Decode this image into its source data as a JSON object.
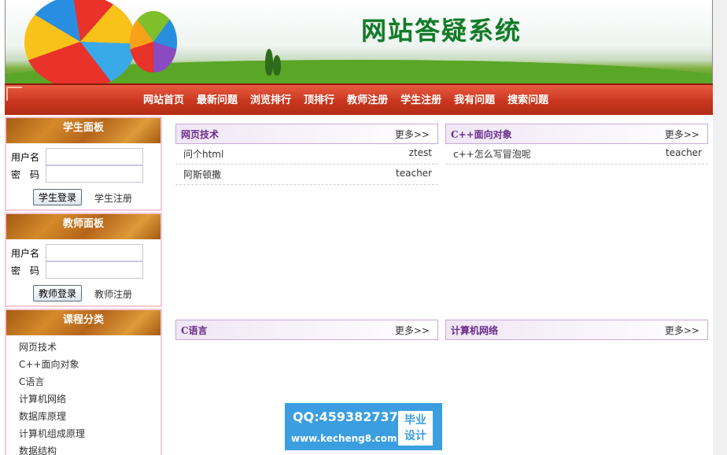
{
  "header": {
    "site_title": "网站答疑系统"
  },
  "nav": {
    "items": [
      "网站首页",
      "最新问题",
      "浏览排行",
      "顶排行",
      "教师注册",
      "学生注册",
      "我有问题",
      "搜索问题"
    ]
  },
  "student_panel": {
    "title": "学生面板",
    "username_label": "用户名",
    "password_label": "密　码",
    "username_value": "",
    "password_value": "",
    "login_button": "学生登录",
    "register_link": "学生注册"
  },
  "teacher_panel": {
    "title": "教师面板",
    "username_label": "用户名",
    "password_label": "密　码",
    "username_value": "",
    "password_value": "",
    "login_button": "教师登录",
    "register_link": "教师注册"
  },
  "category_panel": {
    "title": "课程分类",
    "items": [
      "网页技术",
      "C++面向对象",
      "C语言",
      "计算机网络",
      "数据库原理",
      "计算机组成原理",
      "数据结构"
    ]
  },
  "boxes": [
    {
      "title": "网页技术",
      "more": "更多>>",
      "rows": [
        {
          "question": "问个html",
          "user": "ztest"
        },
        {
          "question": "阿斯顿撒",
          "user": "teacher"
        }
      ]
    },
    {
      "title": "C++面向对象",
      "more": "更多>>",
      "rows": [
        {
          "question": "c++怎么写冒泡呢",
          "user": "teacher"
        }
      ]
    },
    {
      "title": "C语言",
      "more": "更多>>",
      "rows": []
    },
    {
      "title": "计算机网络",
      "more": "更多>>",
      "rows": []
    }
  ],
  "watermark": {
    "qq": "QQ:459382737",
    "url": "www.kecheng8.com",
    "badge_line1": "毕业",
    "badge_line2": "设计"
  },
  "colors": {
    "nav_red": "#c9361f",
    "panel_header_brown": "#b5651a",
    "box_title_purple": "#6a2a8a",
    "title_green": "#137a2a"
  }
}
